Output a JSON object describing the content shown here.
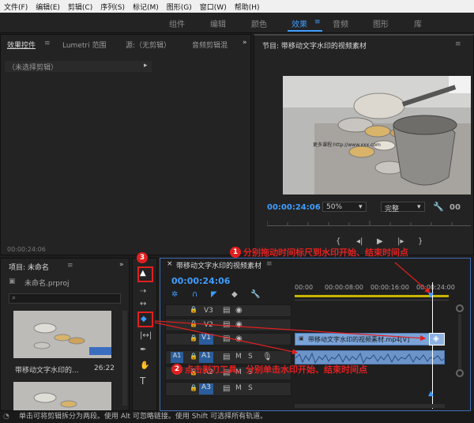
{
  "menu": [
    "文件(F)",
    "编辑(E)",
    "剪辑(C)",
    "序列(S)",
    "标记(M)",
    "图形(G)",
    "窗口(W)",
    "帮助(H)"
  ],
  "workspaces": [
    "组件",
    "编辑",
    "颜色",
    "效果",
    "音频",
    "图形",
    "库"
  ],
  "active_workspace": "效果",
  "topleft": {
    "tabs": [
      "效果控件",
      "Lumetri 范围",
      "源:（无剪辑）",
      "音频剪辑混"
    ],
    "no_clip": "（未选择剪辑）",
    "timecode": "00:00:24:06"
  },
  "program": {
    "title": "节目: 带移动文字水印的视频素材",
    "timecode": "00:00:24:06",
    "zoom": "50%",
    "quality": "完整",
    "watermark": "更多课程:http://www.xxx.com"
  },
  "project": {
    "title": "项目: 未命名",
    "file": "未命名.prproj",
    "clip_name": "带移动文字水印的...",
    "clip_duration": "26:22"
  },
  "timeline": {
    "title": "带移动文字水印的视频素材",
    "timecode": "00:00:24:06",
    "ticks": [
      "00:00",
      "00:00:08:00",
      "00:00:16:00",
      "00:00:24:00"
    ],
    "video_tracks": [
      "V3",
      "V2",
      "V1"
    ],
    "audio_tracks": [
      "A1",
      "A2",
      "A3"
    ],
    "clip_label": "带移动文字水印的视频素材.mp4[V]"
  },
  "annotations": {
    "n1": "1",
    "a1": "分别拖动时间标尺到水印开始、结束时间点",
    "n2": "2",
    "a2": "点击剃刀工具，分别单击水印开始、结束时间点",
    "n3": "3"
  },
  "status": "单击可将剪辑拆分为两段。使用 Alt 可忽略链接。使用 Shift 可选择所有轨道。",
  "colors": {
    "accent": "#3f9dff",
    "annotation": "#e02020",
    "clip": "#7aa3d8"
  }
}
